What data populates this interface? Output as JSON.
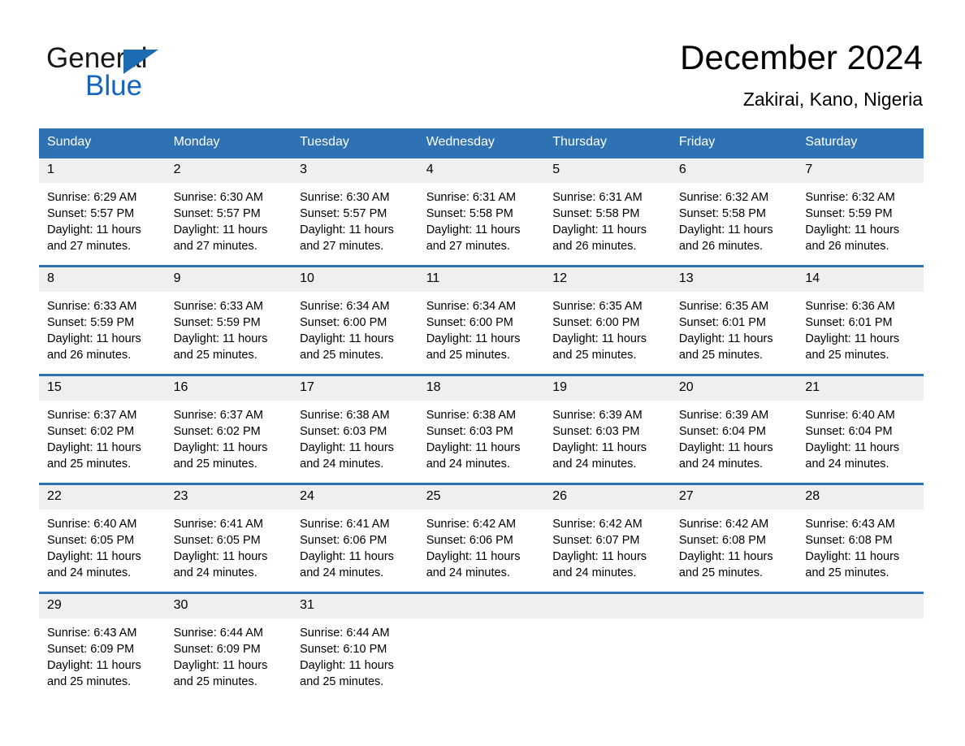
{
  "brand": {
    "word1": "General",
    "word2": "Blue",
    "triangle_color": "#1d6cb2",
    "blue_color": "#1565c0"
  },
  "header": {
    "title": "December 2024",
    "subtitle": "Zakirai, Kano, Nigeria",
    "accent_color": "#2e72b3"
  },
  "calendar": {
    "weekday_headers": [
      "Sunday",
      "Monday",
      "Tuesday",
      "Wednesday",
      "Thursday",
      "Friday",
      "Saturday"
    ],
    "weeks": [
      [
        {
          "day": "1",
          "sunrise": "Sunrise: 6:29 AM",
          "sunset": "Sunset: 5:57 PM",
          "daylight1": "Daylight: 11 hours",
          "daylight2": "and 27 minutes."
        },
        {
          "day": "2",
          "sunrise": "Sunrise: 6:30 AM",
          "sunset": "Sunset: 5:57 PM",
          "daylight1": "Daylight: 11 hours",
          "daylight2": "and 27 minutes."
        },
        {
          "day": "3",
          "sunrise": "Sunrise: 6:30 AM",
          "sunset": "Sunset: 5:57 PM",
          "daylight1": "Daylight: 11 hours",
          "daylight2": "and 27 minutes."
        },
        {
          "day": "4",
          "sunrise": "Sunrise: 6:31 AM",
          "sunset": "Sunset: 5:58 PM",
          "daylight1": "Daylight: 11 hours",
          "daylight2": "and 27 minutes."
        },
        {
          "day": "5",
          "sunrise": "Sunrise: 6:31 AM",
          "sunset": "Sunset: 5:58 PM",
          "daylight1": "Daylight: 11 hours",
          "daylight2": "and 26 minutes."
        },
        {
          "day": "6",
          "sunrise": "Sunrise: 6:32 AM",
          "sunset": "Sunset: 5:58 PM",
          "daylight1": "Daylight: 11 hours",
          "daylight2": "and 26 minutes."
        },
        {
          "day": "7",
          "sunrise": "Sunrise: 6:32 AM",
          "sunset": "Sunset: 5:59 PM",
          "daylight1": "Daylight: 11 hours",
          "daylight2": "and 26 minutes."
        }
      ],
      [
        {
          "day": "8",
          "sunrise": "Sunrise: 6:33 AM",
          "sunset": "Sunset: 5:59 PM",
          "daylight1": "Daylight: 11 hours",
          "daylight2": "and 26 minutes."
        },
        {
          "day": "9",
          "sunrise": "Sunrise: 6:33 AM",
          "sunset": "Sunset: 5:59 PM",
          "daylight1": "Daylight: 11 hours",
          "daylight2": "and 25 minutes."
        },
        {
          "day": "10",
          "sunrise": "Sunrise: 6:34 AM",
          "sunset": "Sunset: 6:00 PM",
          "daylight1": "Daylight: 11 hours",
          "daylight2": "and 25 minutes."
        },
        {
          "day": "11",
          "sunrise": "Sunrise: 6:34 AM",
          "sunset": "Sunset: 6:00 PM",
          "daylight1": "Daylight: 11 hours",
          "daylight2": "and 25 minutes."
        },
        {
          "day": "12",
          "sunrise": "Sunrise: 6:35 AM",
          "sunset": "Sunset: 6:00 PM",
          "daylight1": "Daylight: 11 hours",
          "daylight2": "and 25 minutes."
        },
        {
          "day": "13",
          "sunrise": "Sunrise: 6:35 AM",
          "sunset": "Sunset: 6:01 PM",
          "daylight1": "Daylight: 11 hours",
          "daylight2": "and 25 minutes."
        },
        {
          "day": "14",
          "sunrise": "Sunrise: 6:36 AM",
          "sunset": "Sunset: 6:01 PM",
          "daylight1": "Daylight: 11 hours",
          "daylight2": "and 25 minutes."
        }
      ],
      [
        {
          "day": "15",
          "sunrise": "Sunrise: 6:37 AM",
          "sunset": "Sunset: 6:02 PM",
          "daylight1": "Daylight: 11 hours",
          "daylight2": "and 25 minutes."
        },
        {
          "day": "16",
          "sunrise": "Sunrise: 6:37 AM",
          "sunset": "Sunset: 6:02 PM",
          "daylight1": "Daylight: 11 hours",
          "daylight2": "and 25 minutes."
        },
        {
          "day": "17",
          "sunrise": "Sunrise: 6:38 AM",
          "sunset": "Sunset: 6:03 PM",
          "daylight1": "Daylight: 11 hours",
          "daylight2": "and 24 minutes."
        },
        {
          "day": "18",
          "sunrise": "Sunrise: 6:38 AM",
          "sunset": "Sunset: 6:03 PM",
          "daylight1": "Daylight: 11 hours",
          "daylight2": "and 24 minutes."
        },
        {
          "day": "19",
          "sunrise": "Sunrise: 6:39 AM",
          "sunset": "Sunset: 6:03 PM",
          "daylight1": "Daylight: 11 hours",
          "daylight2": "and 24 minutes."
        },
        {
          "day": "20",
          "sunrise": "Sunrise: 6:39 AM",
          "sunset": "Sunset: 6:04 PM",
          "daylight1": "Daylight: 11 hours",
          "daylight2": "and 24 minutes."
        },
        {
          "day": "21",
          "sunrise": "Sunrise: 6:40 AM",
          "sunset": "Sunset: 6:04 PM",
          "daylight1": "Daylight: 11 hours",
          "daylight2": "and 24 minutes."
        }
      ],
      [
        {
          "day": "22",
          "sunrise": "Sunrise: 6:40 AM",
          "sunset": "Sunset: 6:05 PM",
          "daylight1": "Daylight: 11 hours",
          "daylight2": "and 24 minutes."
        },
        {
          "day": "23",
          "sunrise": "Sunrise: 6:41 AM",
          "sunset": "Sunset: 6:05 PM",
          "daylight1": "Daylight: 11 hours",
          "daylight2": "and 24 minutes."
        },
        {
          "day": "24",
          "sunrise": "Sunrise: 6:41 AM",
          "sunset": "Sunset: 6:06 PM",
          "daylight1": "Daylight: 11 hours",
          "daylight2": "and 24 minutes."
        },
        {
          "day": "25",
          "sunrise": "Sunrise: 6:42 AM",
          "sunset": "Sunset: 6:06 PM",
          "daylight1": "Daylight: 11 hours",
          "daylight2": "and 24 minutes."
        },
        {
          "day": "26",
          "sunrise": "Sunrise: 6:42 AM",
          "sunset": "Sunset: 6:07 PM",
          "daylight1": "Daylight: 11 hours",
          "daylight2": "and 24 minutes."
        },
        {
          "day": "27",
          "sunrise": "Sunrise: 6:42 AM",
          "sunset": "Sunset: 6:08 PM",
          "daylight1": "Daylight: 11 hours",
          "daylight2": "and 25 minutes."
        },
        {
          "day": "28",
          "sunrise": "Sunrise: 6:43 AM",
          "sunset": "Sunset: 6:08 PM",
          "daylight1": "Daylight: 11 hours",
          "daylight2": "and 25 minutes."
        }
      ],
      [
        {
          "day": "29",
          "sunrise": "Sunrise: 6:43 AM",
          "sunset": "Sunset: 6:09 PM",
          "daylight1": "Daylight: 11 hours",
          "daylight2": "and 25 minutes."
        },
        {
          "day": "30",
          "sunrise": "Sunrise: 6:44 AM",
          "sunset": "Sunset: 6:09 PM",
          "daylight1": "Daylight: 11 hours",
          "daylight2": "and 25 minutes."
        },
        {
          "day": "31",
          "sunrise": "Sunrise: 6:44 AM",
          "sunset": "Sunset: 6:10 PM",
          "daylight1": "Daylight: 11 hours",
          "daylight2": "and 25 minutes."
        },
        {
          "day": "",
          "sunrise": "",
          "sunset": "",
          "daylight1": "",
          "daylight2": ""
        },
        {
          "day": "",
          "sunrise": "",
          "sunset": "",
          "daylight1": "",
          "daylight2": ""
        },
        {
          "day": "",
          "sunrise": "",
          "sunset": "",
          "daylight1": "",
          "daylight2": ""
        },
        {
          "day": "",
          "sunrise": "",
          "sunset": "",
          "daylight1": "",
          "daylight2": ""
        }
      ]
    ]
  }
}
